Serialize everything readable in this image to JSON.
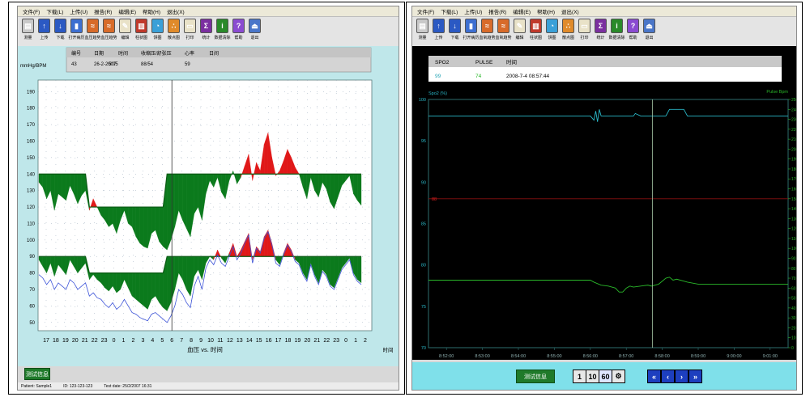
{
  "left": {
    "menu": [
      "文件(F)",
      "下载(L)",
      "上传(U)",
      "报告(R)",
      "编辑(E)",
      "帮助(H)",
      "退出(X)"
    ],
    "toolbar": [
      {
        "label": "测量",
        "icon": "document-icon",
        "color": "#c9c9c9"
      },
      {
        "label": "上传",
        "icon": "up-arrow-icon",
        "color": "#2b59c3"
      },
      {
        "label": "下载",
        "icon": "down-arrow-icon",
        "color": "#2b59c3"
      },
      {
        "label": "打开病历",
        "icon": "book-icon",
        "color": "#3d6fd1"
      },
      {
        "label": "血压趋势",
        "icon": "trend-icon",
        "color": "#d86b2a"
      },
      {
        "label": "血压趋势",
        "icon": "trend-icon",
        "color": "#d86b2a"
      },
      {
        "label": "编辑",
        "icon": "edit-icon",
        "color": "#e9e2c8"
      },
      {
        "label": "柱状图",
        "icon": "bar-chart-icon",
        "color": "#c0392b"
      },
      {
        "label": "饼图",
        "icon": "pie-chart-icon",
        "color": "#3aa0d8"
      },
      {
        "label": "散点图",
        "icon": "scatter-icon",
        "color": "#e08a2a"
      },
      {
        "label": "打印",
        "icon": "print-icon",
        "color": "#e9e2c8"
      },
      {
        "label": "统计",
        "icon": "sigma-icon",
        "color": "#7b2fa0"
      },
      {
        "label": "数据清除",
        "icon": "info-icon",
        "color": "#2a8a2a"
      },
      {
        "label": "帮助",
        "icon": "help-book-icon",
        "color": "#8a4bd1"
      },
      {
        "label": "退出",
        "icon": "exit-icon",
        "color": "#4a76c9"
      }
    ],
    "unit_label": "mmHg/BPM",
    "info_table": {
      "headers": [
        "编号",
        "日期",
        "时间",
        "收缩压/舒张压",
        "心率",
        "日间"
      ],
      "values": [
        "43",
        "26-2-2007",
        "5:05",
        "88/54",
        "59",
        ""
      ]
    },
    "status": {
      "patient": "Patient: Sample1",
      "id": "ID: 123-123-123",
      "date": "Test date: 25/2/2007 16:31"
    },
    "button_label": "测试信息",
    "chart_data": {
      "type": "area",
      "xlabel": "血压 vs. 时间",
      "x_end_label": "时间",
      "y_ticks": [
        50,
        60,
        70,
        80,
        90,
        100,
        110,
        120,
        130,
        140,
        150,
        160,
        170,
        180,
        190
      ],
      "ylim": [
        45,
        197
      ],
      "x_ticks": [
        "17",
        "18",
        "19",
        "20",
        "21",
        "22",
        "23",
        "0",
        "1",
        "2",
        "3",
        "4",
        "5",
        "6",
        "7",
        "8",
        "9",
        "10",
        "11",
        "12",
        "13",
        "14",
        "15",
        "16",
        "17",
        "18",
        "19",
        "20",
        "21",
        "22",
        "23",
        "0",
        "1",
        "2"
      ],
      "cursor_x_index": 13,
      "threshold_systolic_day": 140,
      "threshold_systolic_night": 120,
      "threshold_diastolic_day": 90,
      "threshold_diastolic_night": 80,
      "night_range": [
        5,
        13
      ],
      "systolic": [
        135,
        132,
        125,
        130,
        118,
        128,
        126,
        124,
        133,
        128,
        122,
        127,
        130,
        118,
        125,
        120,
        115,
        112,
        108,
        110,
        104,
        112,
        118,
        110,
        108,
        102,
        98,
        96,
        95,
        104,
        106,
        99,
        96,
        94,
        100,
        108,
        118,
        112,
        107,
        102,
        116,
        120,
        112,
        128,
        136,
        132,
        138,
        129,
        125,
        136,
        142,
        134,
        138,
        145,
        152,
        136,
        147,
        142,
        158,
        165,
        150,
        139,
        142,
        148,
        155,
        150,
        144,
        140,
        132,
        125,
        138,
        130,
        126,
        135,
        131,
        123,
        119,
        126,
        133,
        136,
        139,
        128,
        124,
        121
      ],
      "diastolic": [
        88,
        84,
        80,
        86,
        78,
        85,
        82,
        79,
        88,
        84,
        80,
        83,
        86,
        76,
        79,
        76,
        74,
        71,
        69,
        72,
        68,
        70,
        76,
        71,
        66,
        64,
        62,
        60,
        58,
        64,
        66,
        62,
        59,
        57,
        62,
        70,
        80,
        76,
        70,
        66,
        78,
        82,
        76,
        86,
        90,
        88,
        94,
        89,
        86,
        92,
        98,
        90,
        94,
        99,
        104,
        88,
        96,
        93,
        102,
        106,
        98,
        88,
        85,
        92,
        98,
        94,
        88,
        86,
        80,
        76,
        86,
        79,
        74,
        82,
        79,
        73,
        71,
        77,
        83,
        86,
        89,
        80,
        76,
        74
      ],
      "heart_rate": [
        79,
        77,
        73,
        76,
        70,
        74,
        72,
        70,
        76,
        74,
        70,
        72,
        74,
        66,
        68,
        65,
        64,
        61,
        59,
        62,
        58,
        60,
        64,
        60,
        56,
        55,
        53,
        52,
        51,
        55,
        56,
        54,
        52,
        50,
        54,
        60,
        70,
        67,
        62,
        59,
        72,
        78,
        70,
        83,
        88,
        85,
        91,
        86,
        84,
        90,
        96,
        88,
        92,
        98,
        103,
        86,
        95,
        92,
        101,
        105,
        97,
        86,
        84,
        91,
        97,
        93,
        87,
        85,
        79,
        75,
        85,
        78,
        73,
        81,
        78,
        72,
        70,
        76,
        82,
        85,
        88,
        79,
        75,
        73
      ]
    }
  },
  "right": {
    "menu": [
      "文件(F)",
      "下载(L)",
      "上传(U)",
      "报告(R)",
      "编辑(E)",
      "帮助(H)",
      "退出(X)"
    ],
    "toolbar": [
      {
        "label": "测量",
        "icon": "document-icon",
        "color": "#c9c9c9"
      },
      {
        "label": "上传",
        "icon": "up-arrow-icon",
        "color": "#2b59c3"
      },
      {
        "label": "下载",
        "icon": "down-arrow-icon",
        "color": "#2b59c3"
      },
      {
        "label": "打开病历",
        "icon": "book-icon",
        "color": "#3d6fd1"
      },
      {
        "label": "血氧趋势",
        "icon": "trend-icon",
        "color": "#d86b2a"
      },
      {
        "label": "血氧趋势",
        "icon": "trend-icon",
        "color": "#d86b2a"
      },
      {
        "label": "编辑",
        "icon": "edit-icon",
        "color": "#e9e2c8"
      },
      {
        "label": "柱状图",
        "icon": "bar-chart-icon",
        "color": "#c0392b"
      },
      {
        "label": "饼图",
        "icon": "pie-chart-icon",
        "color": "#3aa0d8"
      },
      {
        "label": "散点图",
        "icon": "scatter-icon",
        "color": "#e08a2a"
      },
      {
        "label": "打印",
        "icon": "print-icon",
        "color": "#e9e2c8"
      },
      {
        "label": "统计",
        "icon": "sigma-icon",
        "color": "#7b2fa0"
      },
      {
        "label": "数据清除",
        "icon": "info-icon",
        "color": "#2a8a2a"
      },
      {
        "label": "帮助",
        "icon": "help-book-icon",
        "color": "#8a4bd1"
      },
      {
        "label": "退出",
        "icon": "exit-icon",
        "color": "#4a76c9"
      }
    ],
    "info_table": {
      "headers": [
        "SPO2",
        "PULSE",
        "时间"
      ],
      "values": [
        "99",
        "74",
        "2008-7-4 08:57:44"
      ]
    },
    "button_label": "测试信息",
    "nav_buttons": [
      "1",
      "10",
      "60"
    ],
    "nav_arrows": [
      "«",
      "‹",
      "›",
      "»"
    ],
    "chart_data": {
      "type": "line",
      "y_left_label": "Spo2 (%)",
      "y_right_label": "Pulse Bpm",
      "y_left_ticks": [
        70,
        75,
        80,
        85,
        90,
        95,
        100
      ],
      "y_left_lim": [
        70,
        100
      ],
      "y_right_ticks": [
        250,
        240,
        230,
        220,
        210,
        200,
        190,
        180,
        170,
        160,
        150,
        140,
        130,
        120,
        110,
        100,
        90,
        80,
        70,
        60,
        50,
        40,
        30,
        20,
        10,
        0
      ],
      "y_right_lim": [
        0,
        250
      ],
      "x_ticks": [
        "8:52:00",
        "8:53:00",
        "8:54:00",
        "8:55:00",
        "8:56:00",
        "8:57:00",
        "8:58:00",
        "8:59:00",
        "9:00:00",
        "9:01:00"
      ],
      "alarm_marker": "88",
      "alarm_level_spo2": 88,
      "cursor_time_min": 57.73,
      "spo2_series": [
        [
          51.5,
          98
        ],
        [
          56.0,
          98
        ],
        [
          56.1,
          97.5
        ],
        [
          56.15,
          98.6
        ],
        [
          56.2,
          97.3
        ],
        [
          56.25,
          98.8
        ],
        [
          56.3,
          98
        ],
        [
          57.2,
          98
        ],
        [
          57.25,
          98.3
        ],
        [
          57.4,
          98
        ],
        [
          58.1,
          98
        ],
        [
          58.2,
          98.8
        ],
        [
          58.6,
          98.8
        ],
        [
          58.7,
          98
        ],
        [
          61.5,
          98
        ]
      ],
      "pulse_series": [
        [
          51.5,
          68
        ],
        [
          56.0,
          68
        ],
        [
          56.1,
          66
        ],
        [
          56.3,
          63
        ],
        [
          56.5,
          62
        ],
        [
          56.7,
          60
        ],
        [
          56.8,
          56
        ],
        [
          56.9,
          56
        ],
        [
          57.0,
          60
        ],
        [
          57.1,
          62
        ],
        [
          57.2,
          61
        ],
        [
          57.4,
          62
        ],
        [
          57.6,
          63
        ],
        [
          57.7,
          62
        ],
        [
          57.9,
          64
        ],
        [
          58.0,
          67
        ],
        [
          58.1,
          70
        ],
        [
          58.2,
          71
        ],
        [
          58.3,
          68
        ],
        [
          58.4,
          69
        ],
        [
          58.6,
          67
        ],
        [
          58.7,
          66
        ],
        [
          59.0,
          64
        ],
        [
          61.5,
          64
        ]
      ]
    }
  }
}
